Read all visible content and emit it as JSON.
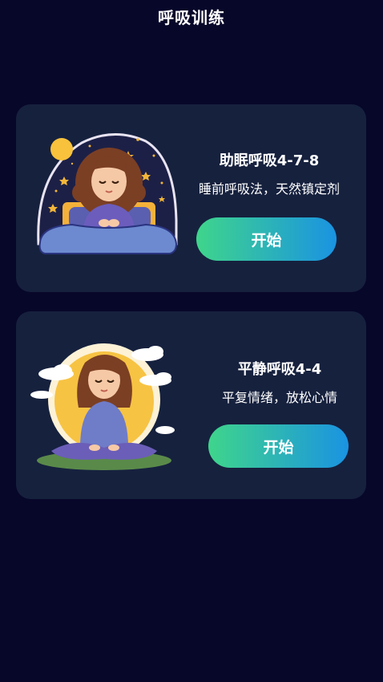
{
  "page": {
    "title": "呼吸训练"
  },
  "exercises": [
    {
      "name": "助眠呼吸4-7-8",
      "description": "睡前呼吸法，天然镇定剂",
      "button_label": "开始",
      "illustration": "sleeping-girl-in-bed-with-moon-and-stars"
    },
    {
      "name": "平静呼吸4-4",
      "description": "平复情绪，放松心情",
      "button_label": "开始",
      "illustration": "meditating-girl-with-sun-and-clouds"
    }
  ],
  "colors": {
    "background": "#07072a",
    "card": "#16213e",
    "button_gradient_start": "#3fd58b",
    "button_gradient_end": "#1a93e2"
  }
}
